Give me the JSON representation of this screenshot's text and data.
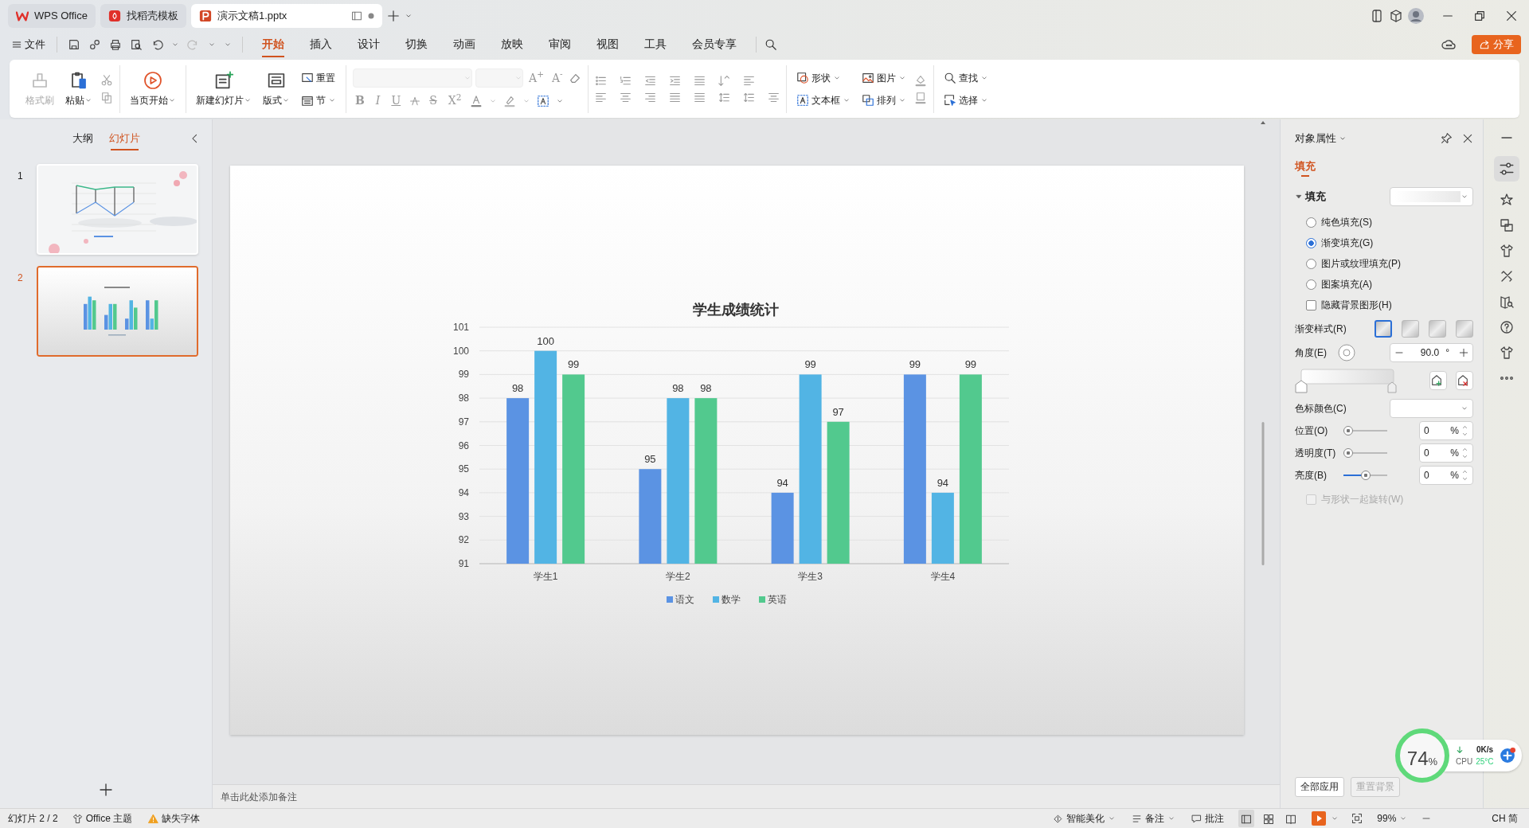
{
  "title_tabs": [
    {
      "label": "WPS Office",
      "selected": false
    },
    {
      "label": "找稻壳模板",
      "selected": false
    },
    {
      "label": "演示文稿1.pptx",
      "selected": true
    }
  ],
  "menu": {
    "file": "文件",
    "tabs": [
      {
        "label": "开始",
        "selected": true
      },
      {
        "label": "插入",
        "selected": false
      },
      {
        "label": "设计",
        "selected": false
      },
      {
        "label": "切换",
        "selected": false
      },
      {
        "label": "动画",
        "selected": false
      },
      {
        "label": "放映",
        "selected": false
      },
      {
        "label": "审阅",
        "selected": false
      },
      {
        "label": "视图",
        "selected": false
      },
      {
        "label": "工具",
        "selected": false
      },
      {
        "label": "会员专享",
        "selected": false
      }
    ],
    "share": "分享"
  },
  "ribbon": {
    "clipboard": [
      {
        "label": "格式刷",
        "disabled": true
      },
      {
        "label": "粘贴",
        "disabled": false
      }
    ],
    "play": "当页开始",
    "slides": [
      "新建幻灯片",
      "版式",
      "重置",
      "节"
    ],
    "size_buttons": [
      "A$^{+}$",
      "A$^{-}$"
    ],
    "font_buttons": [
      "B",
      "I",
      "U",
      "S",
      "X$^{2}$"
    ],
    "drawing": [
      "形状",
      "文本框",
      "图片",
      "排列"
    ],
    "edit": [
      "查找",
      "选择"
    ]
  },
  "panel": {
    "tabs": [
      {
        "label": "大纲",
        "selected": false
      },
      {
        "label": "幻灯片",
        "selected": true
      }
    ],
    "slides": [
      {
        "number": "1",
        "selected": false
      },
      {
        "number": "2",
        "selected": true
      }
    ]
  },
  "slide": {
    "chart_data": {
      "type": "bar",
      "title": "学生成绩统计",
      "categories": [
        "学生1",
        "学生2",
        "学生3",
        "学生4"
      ],
      "series": [
        {
          "name": "语文",
          "color": "#5b93e3",
          "values": [
            98,
            95,
            94,
            99
          ]
        },
        {
          "name": "数学",
          "color": "#52b4e4",
          "values": [
            100,
            98,
            99,
            94
          ]
        },
        {
          "name": "英语",
          "color": "#52c98e",
          "values": [
            99,
            98,
            97,
            99
          ]
        }
      ],
      "ylim": [
        91,
        101
      ],
      "yticks": [
        91,
        92,
        93,
        94,
        95,
        96,
        97,
        98,
        99,
        100,
        101
      ],
      "data_labels": true,
      "grid": true,
      "legend": true
    }
  },
  "notes": {
    "placeholder": "单击此处添加备注"
  },
  "properties": {
    "title": "对象属性",
    "tabs": [
      {
        "label": "填充",
        "selected": true
      }
    ],
    "section": {
      "label": "填充",
      "expanded": true
    },
    "fill_options": [
      {
        "label": "纯色填充(S)",
        "selected": false
      },
      {
        "label": "渐变填充(G)",
        "selected": true
      },
      {
        "label": "图片或纹理填充(P)",
        "selected": false
      },
      {
        "label": "图案填充(A)",
        "selected": false
      }
    ],
    "hide_background": {
      "label": "隐藏背景图形(H)",
      "checked": false,
      "disabled": false
    },
    "gradient_style": {
      "label": "渐变样式(R)",
      "options": [
        {
          "selected": true
        },
        {
          "selected": false
        },
        {
          "selected": false
        },
        {
          "selected": false
        }
      ]
    },
    "angle": {
      "label": "角度(E)",
      "value": "90.0",
      "unit": "°"
    },
    "stop_color": {
      "label": "色标颜色(C)"
    },
    "sliders": [
      {
        "label": "位置(O)",
        "level": 0,
        "value": "0",
        "unit": "%"
      },
      {
        "label": "透明度(T)",
        "level": 0,
        "value": "0",
        "unit": "%"
      },
      {
        "label": "亮度(B)",
        "level": 0.5,
        "value": "0",
        "unit": "%"
      }
    ],
    "rotate_with_shape": {
      "label": "与形状一起旋转(W)",
      "checked": false,
      "disabled": true
    },
    "buttons": [
      {
        "label": "全部应用",
        "disabled": false
      },
      {
        "label": "重置背景",
        "disabled": true
      }
    ]
  },
  "status_bar": {
    "slide_counter": "幻灯片 2 / 2",
    "theme": "Office 主题",
    "missing_font": "缺失字体",
    "beautify": "智能美化",
    "notes": "备注",
    "comments": "批注",
    "views": [
      {
        "selected": true
      },
      {
        "selected": false
      },
      {
        "selected": false
      }
    ],
    "zoom": "99%",
    "ime": "CH 简"
  },
  "widget": {
    "value": "74",
    "unit": "%",
    "speed": "0K/s",
    "cpu_label": "CPU",
    "temperature": "25°C"
  }
}
